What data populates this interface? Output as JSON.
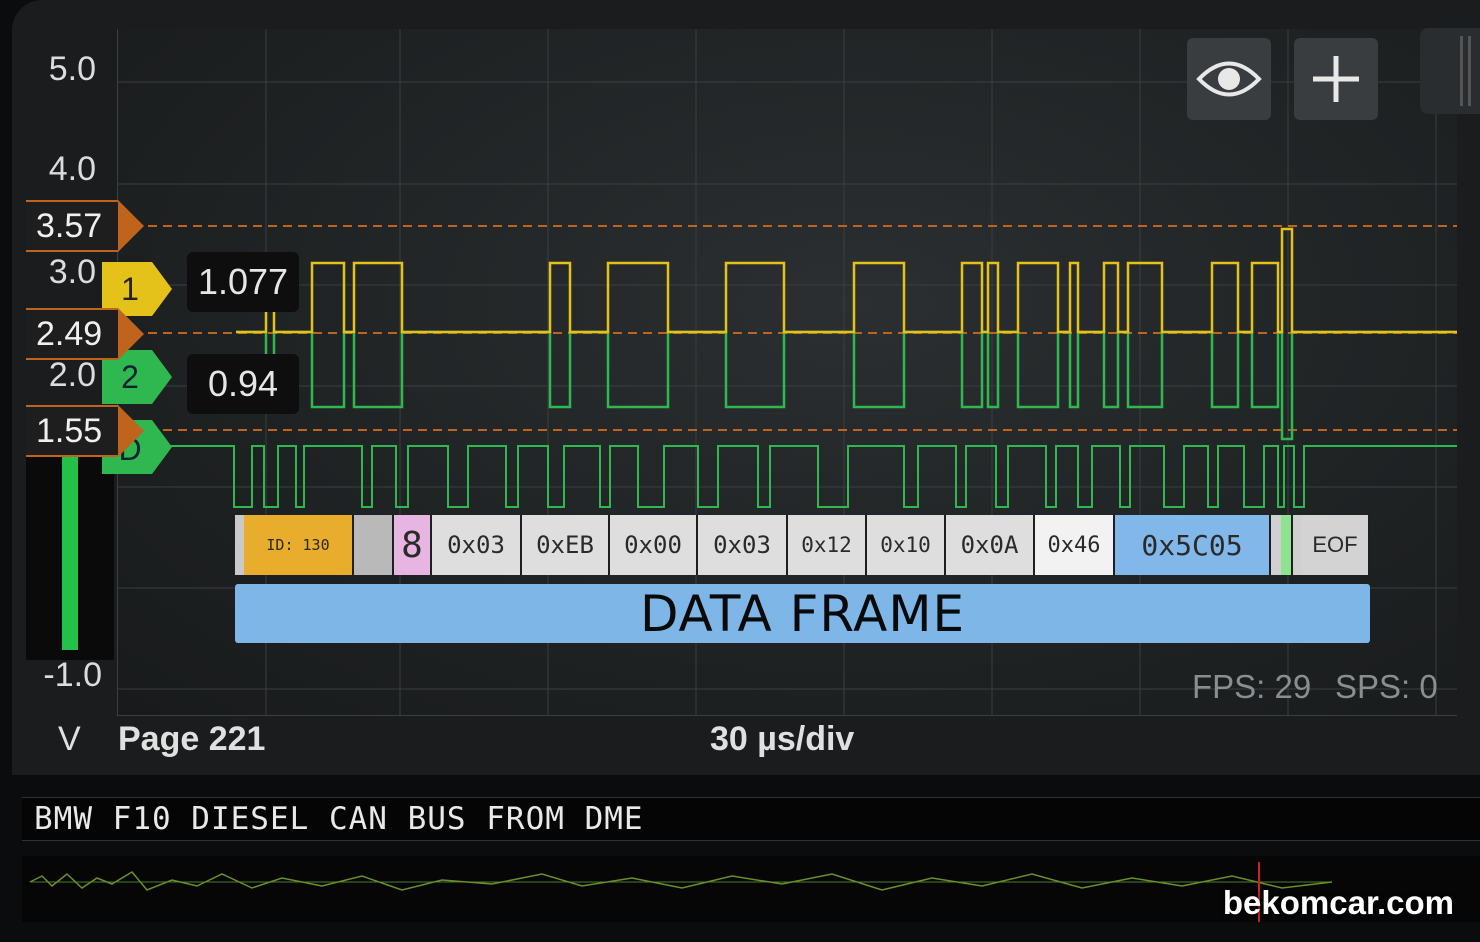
{
  "scope": {
    "y_axis_labels": [
      "5.0",
      "4.0",
      "3.0",
      "2.0",
      "-1.0"
    ],
    "y_unit": "V",
    "page_label": "Page 221",
    "timebase": "30 µs/div",
    "fps_label": "FPS: 29",
    "sps_label": "SPS: 0"
  },
  "cursors": [
    {
      "value": "3.57"
    },
    {
      "value": "2.49"
    },
    {
      "value": "1.55"
    }
  ],
  "channels": [
    {
      "id": "1",
      "color": "#e4c21a",
      "readout": "1.077"
    },
    {
      "id": "2",
      "color": "#2fb84f",
      "readout": "0.94"
    },
    {
      "id": "D",
      "color": "#2fb84f"
    }
  ],
  "toolbar": {
    "view_icon": "eye-icon",
    "add_icon": "plus-icon"
  },
  "decoder": {
    "fields": [
      {
        "label": "ID: 130",
        "color": "#e8ad2c"
      },
      {
        "label": "",
        "color": "#b9b9b9"
      },
      {
        "label": "8",
        "color": "#e6b5e2"
      },
      {
        "label": "0x03",
        "color": "#dedede"
      },
      {
        "label": "0xEB",
        "color": "#dedede"
      },
      {
        "label": "0x00",
        "color": "#dedede"
      },
      {
        "label": "0x03",
        "color": "#dedede"
      },
      {
        "label": "0x12",
        "color": "#dedede"
      },
      {
        "label": "0x10",
        "color": "#dedede"
      },
      {
        "label": "0x0A",
        "color": "#dedede"
      },
      {
        "label": "0x46",
        "color": "#dedede"
      },
      {
        "label": "0x5C05",
        "color": "#82b7ea"
      },
      {
        "label": "",
        "color": "#8fe38e"
      },
      {
        "label": "EOF",
        "color": "#d3d3d3"
      }
    ],
    "frame_label": "DATA FRAME"
  },
  "capture_title": "BMW F10 DIESEL CAN BUS FROM DME",
  "watermark": "bekomcar.com",
  "colors": {
    "cursor": "#c0631c",
    "channel1": "#e4c21a",
    "channel2": "#2fb84f"
  }
}
